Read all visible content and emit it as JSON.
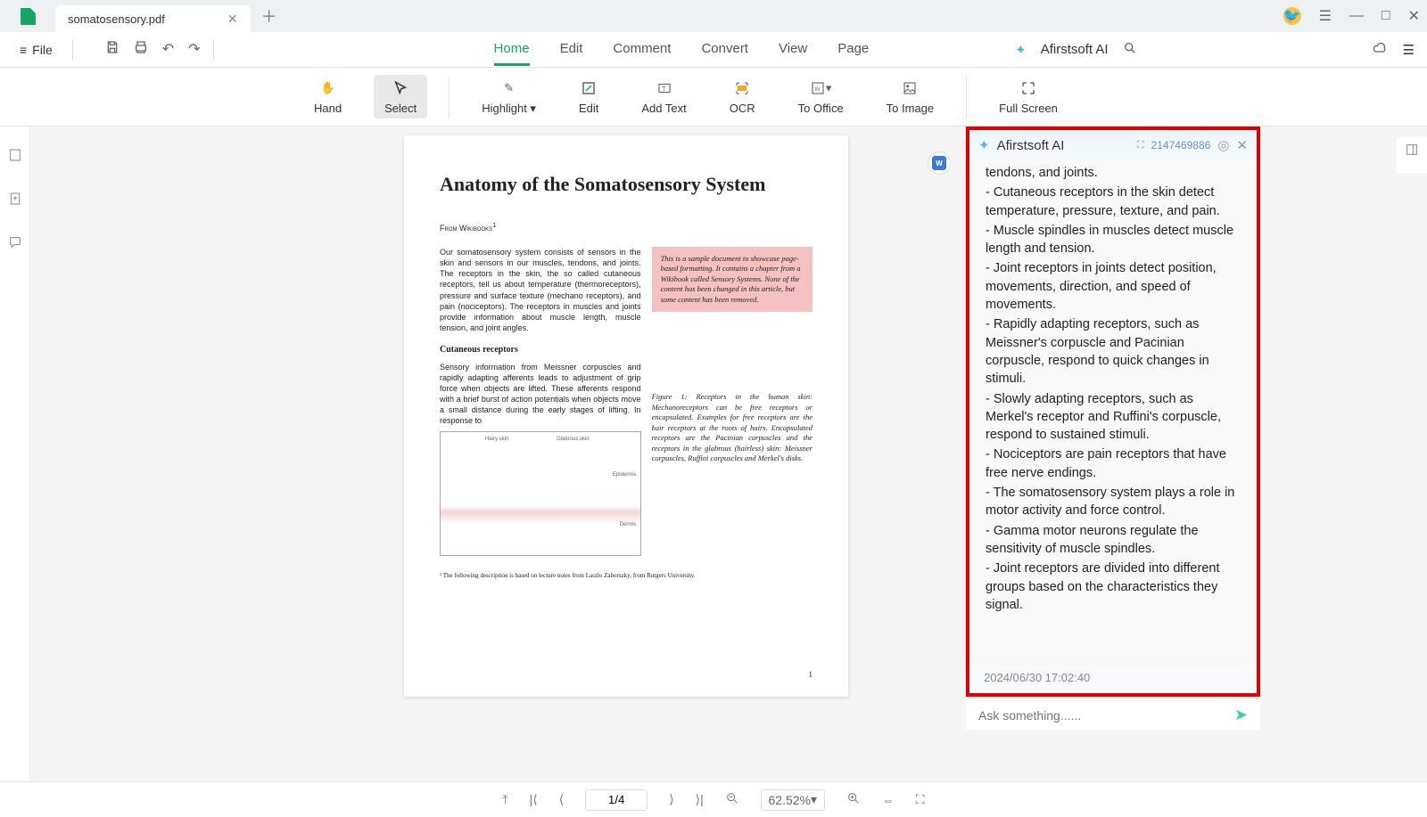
{
  "tab": {
    "title": "somatosensory.pdf"
  },
  "file_menu": {
    "label": "File"
  },
  "menu_tabs": [
    "Home",
    "Edit",
    "Comment",
    "Convert",
    "View",
    "Page"
  ],
  "ai_brand": "Afirstsoft AI",
  "toolbar": {
    "hand": "Hand",
    "select": "Select",
    "highlight": "Highlight",
    "edit": "Edit",
    "add_text": "Add Text",
    "ocr": "OCR",
    "to_office": "To Office",
    "to_image": "To Image",
    "full_screen": "Full Screen"
  },
  "document": {
    "title": "Anatomy of the Somatosensory System",
    "source": "From Wikibooks",
    "para1": "Our somatosensory system consists of sensors in the skin and sensors in our muscles, tendons, and joints. The receptors in the skin, the so called cutaneous receptors, tell us about temperature (thermoreceptors), pressure and surface texture (mechano receptors), and pain (nociceptors). The receptors in muscles and joints provide information about muscle length, muscle tension, and joint angles.",
    "pinkbox": "This is a sample document to showcase page-based formatting. It contains a chapter from a Wikibook called Sensory Systems. None of the content has been changed in this article, but some content has been removed.",
    "sub_heading": "Cutaneous receptors",
    "para2": "Sensory information from Meissner corpuscles and rapidly adapting afferents leads to adjustment of grip force when objects are lifted. These afferents respond with a brief burst of action potentials when objects move a small distance during the early stages of lifting. In response to",
    "fig_caption": "Figure 1: Receptors in the human skin: Mechanoreceptors can be free receptors or encapsulated. Examples for free receptors are the hair receptors at the roots of hairs. Encapsulated receptors are the Pacinian corpuscles and the receptors in the glabrous (hairless) skin: Meissner corpuscles, Ruffini corpuscles and Merkel's disks.",
    "footnote": "¹ The following description is based on lecture notes from Laszlo Zaborszky, from Rutgers University.",
    "page_number": "1"
  },
  "convert_badge": "W",
  "ai_panel": {
    "title": "Afirstsoft AI",
    "id": "2147469886",
    "lines": [
      "tendons, and joints.",
      "- Cutaneous receptors in the skin detect temperature, pressure, texture, and pain.",
      "- Muscle spindles in muscles detect muscle length and tension.",
      "- Joint receptors in joints detect position, movements, direction, and speed of movements.",
      "- Rapidly adapting receptors, such as Meissner's corpuscle and Pacinian corpuscle, respond to quick changes in stimuli.",
      "- Slowly adapting receptors, such as Merkel's receptor and Ruffini's corpuscle, respond to sustained stimuli.",
      "- Nociceptors are pain receptors that have free nerve endings.",
      "- The somatosensory system plays a role in motor activity and force control.",
      "- Gamma motor neurons regulate the sensitivity of muscle spindles.",
      "- Joint receptors are divided into different groups based on the characteristics they signal."
    ],
    "timestamp": "2024/06/30 17:02:40",
    "input_placeholder": "Ask something......"
  },
  "status": {
    "page": "1/4",
    "zoom": "62.52%"
  }
}
